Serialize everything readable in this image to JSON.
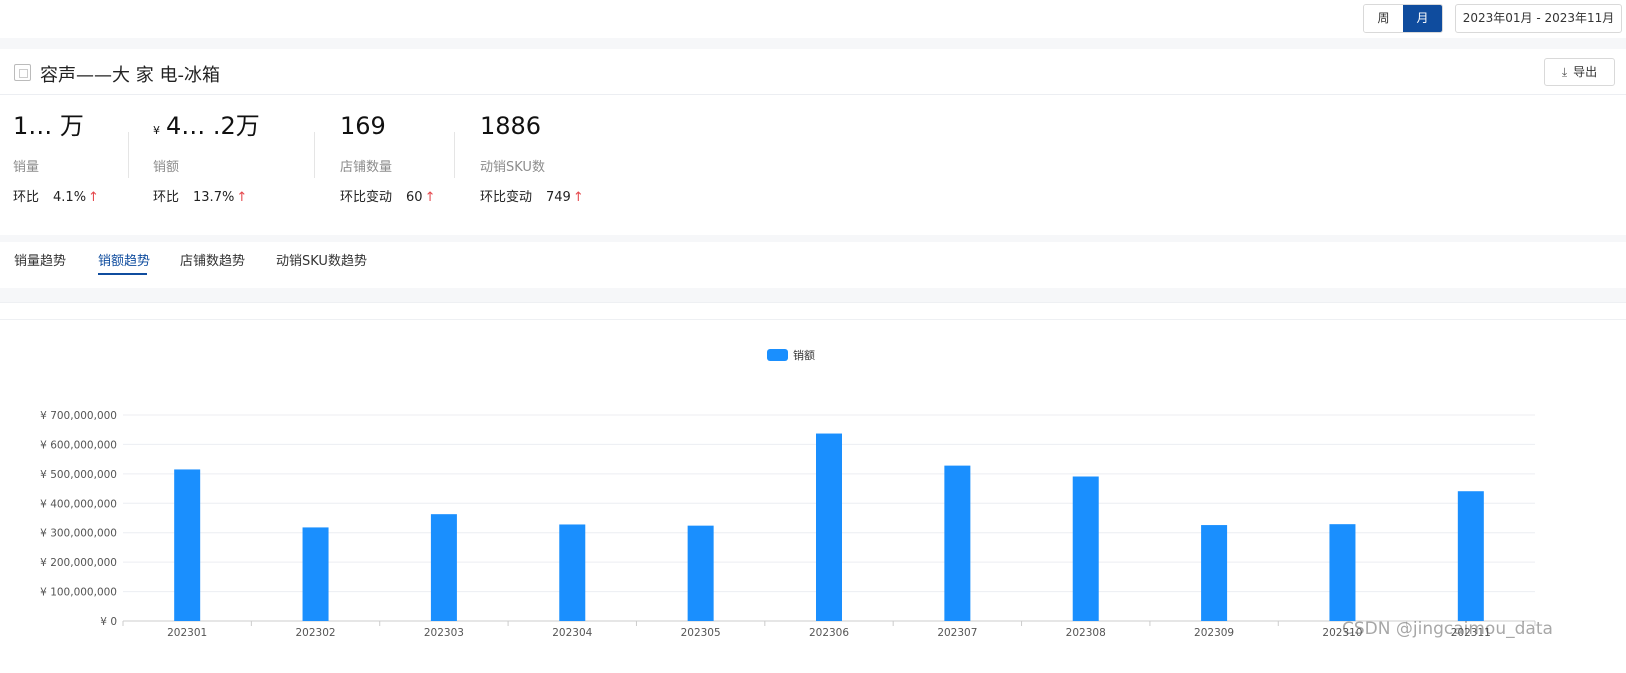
{
  "toolbar": {
    "period_options": [
      "周",
      "月"
    ],
    "period_selected": "月",
    "date_range": "2023年01月 - 2023年11月"
  },
  "store": {
    "name": "容声——大 家 电-冰箱",
    "export_label": "导出"
  },
  "metrics": [
    {
      "value": "1… 万",
      "label": "销量",
      "change_label": "环比",
      "change_value": "4.1%",
      "direction": "up"
    },
    {
      "currency": "¥",
      "value": "4… .2万",
      "label": "销额",
      "change_label": "环比",
      "change_value": "13.7%",
      "direction": "up"
    },
    {
      "value": "169",
      "label": "店铺数量",
      "change_label": "环比变动",
      "change_value": "60",
      "direction": "up"
    },
    {
      "value": "1886",
      "label": "动销SKU数",
      "change_label": "环比变动",
      "change_value": "749",
      "direction": "up"
    }
  ],
  "tabs": [
    "销量趋势",
    "销额趋势",
    "店铺数趋势",
    "动销SKU数趋势"
  ],
  "active_tab": "销额趋势",
  "colors": {
    "accent": "#0f4c9e",
    "bar": "#1a8ffe",
    "up_arrow": "#e5484d"
  },
  "chart_data": {
    "type": "bar",
    "legend": [
      "销额"
    ],
    "legend_position": "top-center",
    "categories": [
      "202301",
      "202302",
      "202303",
      "202304",
      "202305",
      "202306",
      "202307",
      "202308",
      "202309",
      "202310",
      "202311"
    ],
    "series": [
      {
        "name": "销额",
        "values": [
          515000000,
          318000000,
          363000000,
          328000000,
          324000000,
          637000000,
          528000000,
          491000000,
          326000000,
          329000000,
          441000000
        ]
      }
    ],
    "yticks": [
      "¥ 0",
      "¥ 100,000,000",
      "¥ 200,000,000",
      "¥ 300,000,000",
      "¥ 400,000,000",
      "¥ 500,000,000",
      "¥ 600,000,000",
      "¥ 700,000,000"
    ],
    "ylim": [
      0,
      700000000
    ],
    "grid": true
  },
  "watermark": "CSDN @jingcaimou_data"
}
